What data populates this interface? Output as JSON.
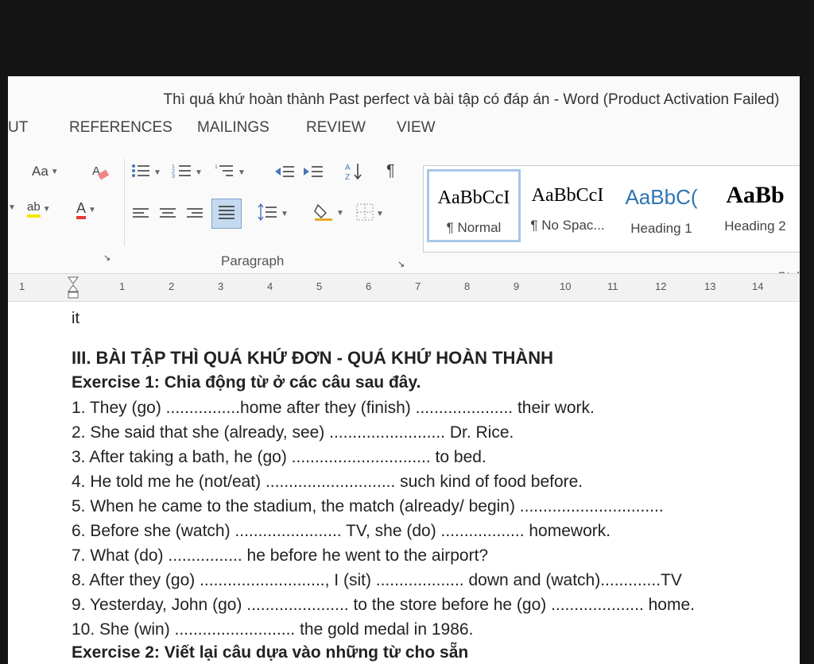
{
  "window": {
    "title": "Thì quá khứ hoàn thành Past perfect và bài tập có đáp án - Word (Product Activation Failed)"
  },
  "tabs": [
    "UT",
    "REFERENCES",
    "MAILINGS",
    "REVIEW",
    "VIEW"
  ],
  "ribbon": {
    "font_size_btn": "Aa",
    "highlight_btn": "ab",
    "font_color_btn": "A",
    "group_label": "Paragraph",
    "styles": [
      {
        "preview": "AaBbCcI",
        "label": "¶ Normal"
      },
      {
        "preview": "AaBbCcI",
        "label": "¶ No Spac..."
      },
      {
        "preview": "AaBbC(",
        "label": "Heading 1"
      },
      {
        "preview": "AaBb",
        "label": "Heading 2"
      }
    ],
    "styles_label": "Styl"
  },
  "ruler": {
    "ticks": [
      "1",
      "1",
      "2",
      "3",
      "4",
      "5",
      "6",
      "7",
      "8",
      "9",
      "10",
      "11",
      "12",
      "13",
      "14"
    ]
  },
  "document": {
    "lines": [
      "it",
      "III. BÀI TẬP THÌ QUÁ KHỨ ĐƠN - QUÁ KHỨ HOÀN THÀNH",
      "Exercise 1: Chia động từ ở các câu sau đây.",
      "1. They (go) ................home after they (finish) ..................... their work.",
      "2. She said that she (already, see) ......................... Dr. Rice.",
      "3. After taking a bath, he (go) .............................. to bed.",
      "4. He told me he (not/eat) ............................ such kind of food before.",
      "5. When he came to the stadium, the match (already/ begin) ...............................",
      "6. Before she (watch) ....................... TV, she (do) .................. homework.",
      "7. What (do) ................ he before he went to the airport?",
      "8. After they (go) ..........................., I (sit) ................... down and (watch).............TV",
      "9. Yesterday, John (go) ...................... to the store before he (go) .................... home.",
      "10. She (win) .......................... the gold medal in 1986.",
      "Exercise 2: Viết lại câu dựa vào những từ cho sẵn"
    ]
  },
  "colors": {
    "heading": "#c0392b",
    "selected_style_border": "#a7c7e7"
  }
}
